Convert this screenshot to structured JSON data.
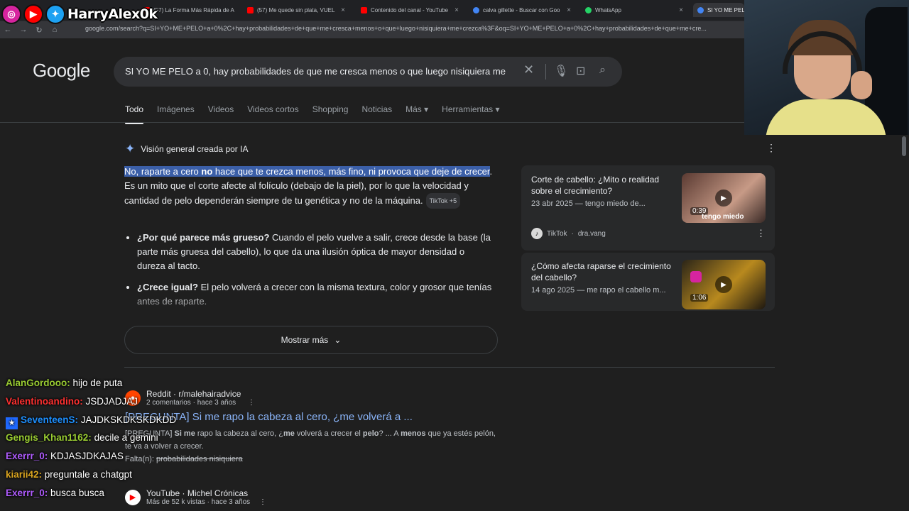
{
  "overlay": {
    "handle": "HarryAlex0k",
    "socials": [
      "instagram-icon",
      "youtube-icon",
      "twitter-icon"
    ]
  },
  "browser": {
    "tabs": [
      {
        "label": "(57) La Forma Más Rápida de A",
        "color": "#ff0000"
      },
      {
        "label": "(57) Me quede sin plata, VUEL",
        "color": "#ff0000"
      },
      {
        "label": "Contenido del canal - YouTube",
        "color": "#ff0000"
      },
      {
        "label": "calva gillette - Buscar con Goo",
        "color": "#4285f4"
      },
      {
        "label": "WhatsApp",
        "color": "#25d366"
      },
      {
        "label": "SI YO ME PELO",
        "color": "#4285f4"
      }
    ],
    "url": "google.com/search?q=SI+YO+ME+PELO+a+0%2C+hay+probabilidades+de+que+me+cresca+menos+o+que+luego+nisiquiera+me+crezca%3F&oq=SI+YO+ME+PELO+a+0%2C+hay+probabilidades+de+que+me+cre..."
  },
  "google": {
    "logo": "Google",
    "query": "SI YO ME PELO a 0, hay probabilidades de que me cresca menos o que luego nisiquiera me",
    "nav": [
      "Todo",
      "Imágenes",
      "Videos",
      "Videos cortos",
      "Shopping",
      "Noticias",
      "Más ▾",
      "Herramientas ▾"
    ]
  },
  "ai_overview": {
    "heading": "Visión general creada por IA",
    "p1_hl_a": "No, raparte a cero ",
    "p1_hl_b": "no",
    "p1_hl_c": " hace que te crezca menos, más fino, ni provoca que deje de crecer",
    "p1_rest": ". Es un mito que el corte afecte al folículo (debajo de la piel), por lo que la velocidad y cantidad de pelo dependerán siempre de tu genética y no de la máquina.",
    "chip": "TikTok +5",
    "b1_bold": "¿Por qué parece más grueso?",
    "b1_text": " Cuando el pelo vuelve a salir, crece desde la base (la parte más gruesa del cabello), lo que da una ilusión óptica de mayor densidad o dureza al tacto.",
    "b2_bold": "¿Crece igual?",
    "b2_text": " El pelo volverá a crecer con la misma textura, color y grosor que tenías antes de raparte.",
    "show_more": "Mostrar más"
  },
  "cards": [
    {
      "title": "Corte de cabello: ¿Mito o realidad sobre el crecimiento?",
      "date": "23 abr 2025 — tengo miedo de...",
      "duration": "0:39",
      "thumb_caption": "tengo miedo",
      "source": "TikTok",
      "author": "dra.vang"
    },
    {
      "title": "¿Cómo afecta raparse el crecimiento del cabello?",
      "date": "14 ago 2025 — me rapo el cabello m...",
      "duration": "1:06"
    }
  ],
  "results": [
    {
      "site": "Reddit · r/malehairadvice",
      "meta": "2 comentarios · hace 3 años",
      "title": "[PREGUNTA] Si me rapo la cabeza al cero, ¿me volverá a ...",
      "snippet_a": "[PREGUNTA] ",
      "snippet_b": "Si me",
      "snippet_c": " rapo la cabeza al cero, ¿",
      "snippet_d": "me",
      "snippet_e": " volverá a crecer el ",
      "snippet_f": "pelo",
      "snippet_g": "? ... A ",
      "snippet_h": "menos",
      "snippet_i": " que ya estés pelón, te va a volver a crecer.",
      "missing": "Falta(n): ",
      "missing_words": "probabilidades nisiquiera"
    },
    {
      "site": "YouTube · Michel Crónicas",
      "meta": "Más de 52 k vistas · hace 3 años"
    }
  ],
  "chat": [
    {
      "user": "AlanGordooo:",
      "color": "#9acd32",
      "text": " hijo de puta"
    },
    {
      "user": "Valentinoandino:",
      "color": "#ff3030",
      "text": " JSDJADJAJ"
    },
    {
      "user": "SeventeenS:",
      "color": "#1e90ff",
      "text": " JAJDKSKDKSKDKDD"
    },
    {
      "user": "Gengis_Khan1162:",
      "color": "#9acd32",
      "text": " decile a gemini"
    },
    {
      "user": "Exerrr_0:",
      "color": "#b05cff",
      "text": " KDJASJDKAJAS"
    },
    {
      "user": "kiarii42:",
      "color": "#daa520",
      "text": " preguntale a chatgpt"
    },
    {
      "user": "Exerrr_0:",
      "color": "#b05cff",
      "text": " busca busca"
    }
  ]
}
